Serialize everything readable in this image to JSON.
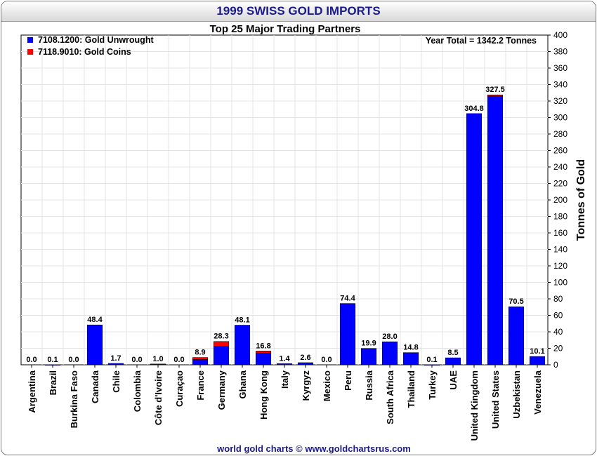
{
  "title": "1999 SWISS GOLD IMPORTS",
  "footer": "world gold charts © www.goldchartsrus.com",
  "colors": {
    "unwrought": "#0000ff",
    "coins": "#ff0000",
    "title": "#1a1a8c",
    "grid": "#e4e4e4"
  },
  "chart_data": {
    "type": "bar",
    "stacked": true,
    "title": "Top 25 Major Trading Partners",
    "annotation": "Year Total = 1342.2 Tonnes",
    "ylabel": "Tonnes of Gold",
    "ylim": [
      0,
      400
    ],
    "yticks": [
      0,
      20,
      40,
      60,
      80,
      100,
      120,
      140,
      160,
      180,
      200,
      220,
      240,
      260,
      280,
      300,
      320,
      340,
      360,
      380,
      400
    ],
    "y_axis_side": "right",
    "grid": true,
    "legend_position": "top-left",
    "categories": [
      "Argentina",
      "Brazil",
      "Burkina Faso",
      "Canada",
      "Chile",
      "Colombia",
      "Côte d'Ivoire",
      "Curaçao",
      "France",
      "Germany",
      "Ghana",
      "Hong Kong",
      "Italy",
      "Kyrgyz",
      "Mexico",
      "Peru",
      "Russia",
      "South Africa",
      "Thailand",
      "Turkey",
      "UAE",
      "United Kingdom",
      "United States",
      "Uzbekistan",
      "Venezuela"
    ],
    "series": [
      {
        "name": "7108.1200: Gold Unwrought",
        "color": "#0000ff",
        "values": [
          0.0,
          0.1,
          0.0,
          48.4,
          1.7,
          0.0,
          1.0,
          0.0,
          6.4,
          22.3,
          48.1,
          14.3,
          1.4,
          2.6,
          0.0,
          74.4,
          19.9,
          28.0,
          14.8,
          0.1,
          8.5,
          304.8,
          326.0,
          70.5,
          10.1
        ]
      },
      {
        "name": "7118.9010: Gold Coins",
        "color": "#ff0000",
        "values": [
          0.0,
          0.0,
          0.0,
          0.0,
          0.0,
          0.0,
          0.0,
          0.0,
          2.5,
          6.0,
          0.0,
          2.5,
          0.0,
          0.0,
          0.0,
          0.0,
          0.0,
          0.0,
          0.0,
          0.0,
          0.0,
          0.0,
          1.5,
          0.0,
          0.0
        ]
      }
    ],
    "totals": [
      "0.0",
      "0.1",
      "0.0",
      "48.4",
      "1.7",
      "0.0",
      "1.0",
      "0.0",
      "8.9",
      "28.3",
      "48.1",
      "16.8",
      "1.4",
      "2.6",
      "0.0",
      "74.4",
      "19.9",
      "28.0",
      "14.8",
      "0.1",
      "8.5",
      "304.8",
      "327.5",
      "70.5",
      "10.1"
    ]
  }
}
